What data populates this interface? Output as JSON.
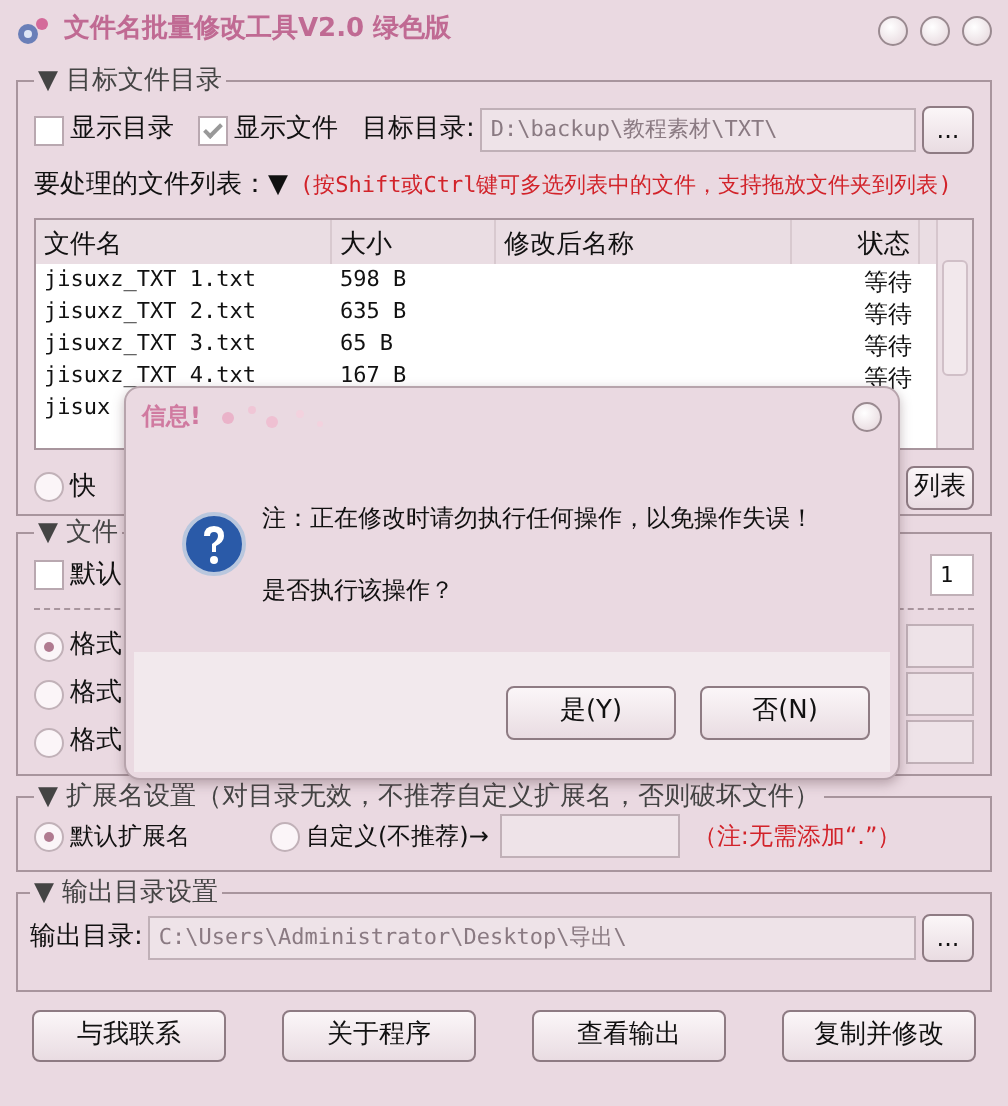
{
  "window": {
    "title": "文件名批量修改工具V2.0  绿色版"
  },
  "target_group": {
    "legend": "▼ 目标文件目录",
    "show_dirs": {
      "label": "显示目录",
      "checked": false
    },
    "show_files": {
      "label": "显示文件",
      "checked": true
    },
    "dir_label": "目标目录:",
    "dir_value": "D:\\backup\\教程素材\\TXT\\",
    "browse": "...",
    "list_label": "要处理的文件列表：▼",
    "list_hint": "(按Shift或Ctrl键可多选列表中的文件，支持拖放文件夹到列表)",
    "table": {
      "columns": [
        "文件名",
        "大小",
        "修改后名称",
        "状态"
      ],
      "rows": [
        {
          "name": "jisuxz_TXT 1.txt",
          "size": "598 B",
          "status": "等待"
        },
        {
          "name": "jisuxz_TXT 2.txt",
          "size": "635 B",
          "status": "等待"
        },
        {
          "name": "jisuxz_TXT 3.txt",
          "size": "65 B",
          "status": "等待"
        },
        {
          "name": "jisuxz_TXT 4.txt",
          "size": "167 B",
          "status": "等待"
        },
        {
          "name": "jisux"
        }
      ]
    },
    "quick": {
      "label": "快",
      "selected": false
    },
    "list_button": "列表"
  },
  "file_group": {
    "legend": "▼ 文件",
    "default": {
      "label": "默认",
      "checked": false
    },
    "count_value": "1",
    "formats": [
      {
        "label": "格式",
        "selected": true
      },
      {
        "label": "格式",
        "selected": false
      },
      {
        "label": "格式",
        "selected": false
      }
    ]
  },
  "ext_group": {
    "legend": "▼ 扩展名设置（对目录无效，不推荐自定义扩展名，否则破坏文件）",
    "options": [
      {
        "label": "默认扩展名",
        "selected": true
      },
      {
        "label": "自定义(不推荐)→",
        "selected": false
      }
    ],
    "note": "（注:无需添加“.”）"
  },
  "output_group": {
    "legend": "▼ 输出目录设置",
    "label": "输出目录:",
    "value": "C:\\Users\\Administrator\\Desktop\\导出\\",
    "browse": "..."
  },
  "buttons": [
    "与我联系",
    "关于程序",
    "查看输出",
    "复制并修改"
  ],
  "dialog": {
    "title": "信息!",
    "message": "注：正在修改时请勿执行任何操作，以免操作失误！",
    "question": "是否执行该操作？",
    "buttons": [
      "是(Y)",
      "否(N)"
    ]
  }
}
